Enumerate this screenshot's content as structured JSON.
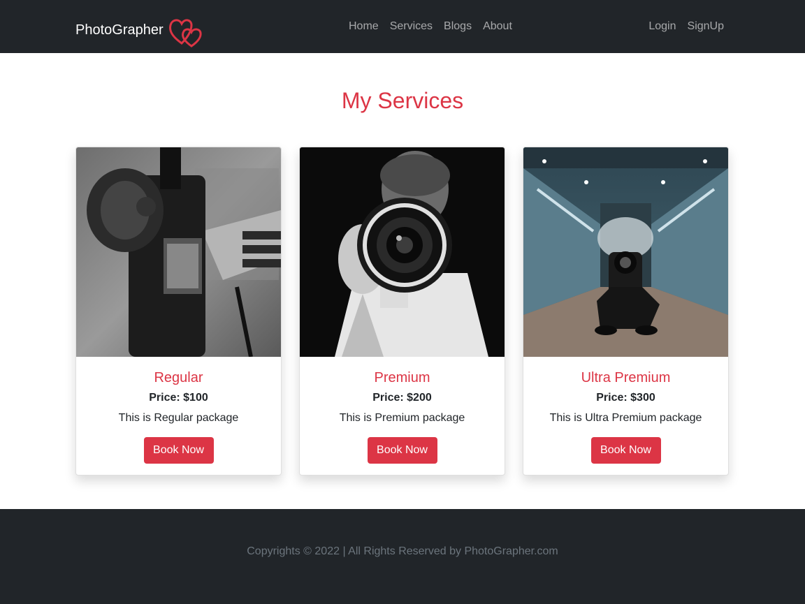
{
  "navbar": {
    "brand": "PhotoGrapher",
    "logo_icon": "double-heart-icon",
    "links": [
      "Home",
      "Services",
      "Blogs",
      "About"
    ],
    "auth_links": [
      "Login",
      "SignUp"
    ]
  },
  "main": {
    "title": "My Services",
    "cards": [
      {
        "title": "Regular",
        "price": "Price: $100",
        "description": "This is Regular package",
        "button": "Book Now",
        "image": "camera-held-grayscale"
      },
      {
        "title": "Premium",
        "price": "Price: $200",
        "description": "This is Premium package",
        "button": "Book Now",
        "image": "photographer-lens-closeup"
      },
      {
        "title": "Ultra Premium",
        "price": "Price: $300",
        "description": "This is Ultra Premium package",
        "button": "Book Now",
        "image": "photographer-escalator-smoke"
      }
    ]
  },
  "footer": {
    "text": "Copyrights © 2022 | All Rights Reserved by PhotoGrapher.com"
  },
  "colors": {
    "accent": "#dc3545",
    "navbar_bg": "#212529",
    "footer_text": "#6c757d"
  }
}
